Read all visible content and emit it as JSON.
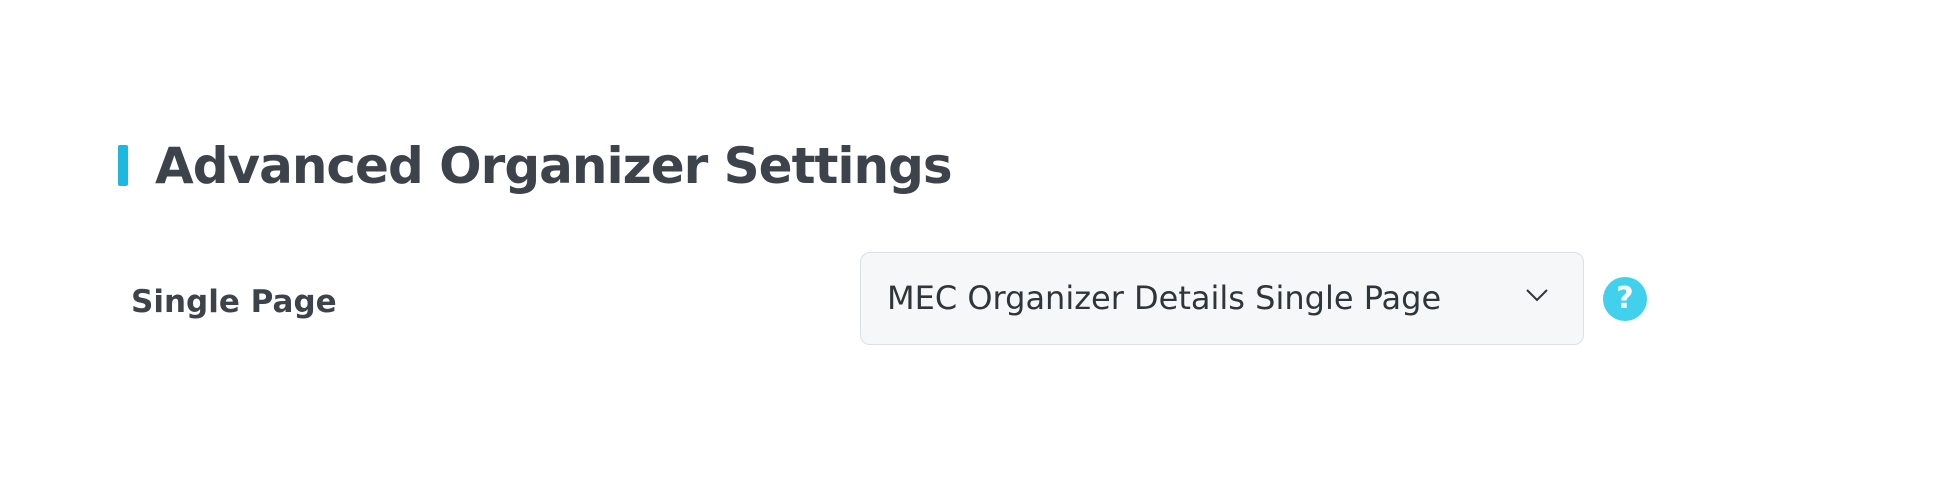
{
  "section": {
    "title": "Advanced Organizer Settings",
    "accent_color": "#1bb8e0"
  },
  "fields": {
    "single_page": {
      "label": "Single Page",
      "selected_value": "MEC Organizer Details Single Page"
    }
  },
  "help": {
    "icon": "help-icon",
    "glyph": "?",
    "color": "#42d1ec"
  }
}
